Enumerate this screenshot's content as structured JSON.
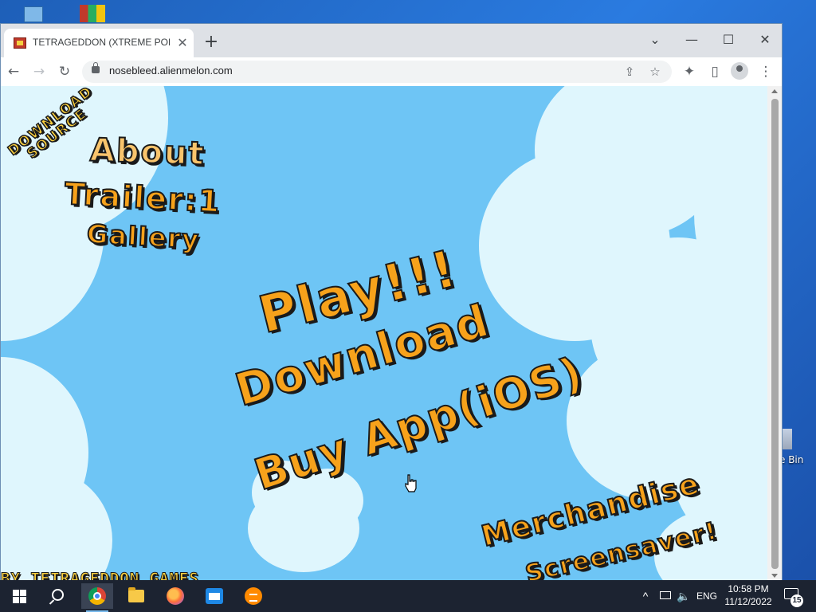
{
  "browser": {
    "tab_title": "TETRAGEDDON (XTREME POLYGON",
    "tab_close": "✕",
    "new_tab": "+",
    "url": "nosebleed.alienmelon.com",
    "window_controls": {
      "list": "⌄",
      "minimize": "—",
      "maximize": "☐",
      "close": "✕"
    },
    "nav": {
      "back": "←",
      "forward": "→",
      "reload": "↻",
      "share": "⇪",
      "bookmark": "☆",
      "extensions": "✦",
      "sidebar": "▯",
      "menu": "⋮"
    }
  },
  "page": {
    "download_label": "DOWNLOAD",
    "source_label": "SOURCE",
    "about_label": "About",
    "trailer_label": "Trailer:1",
    "gallery_label": "Gallery",
    "play_label": "Play!!!",
    "download_main_label": "Download",
    "buy_app_label": "Buy App(iOS)",
    "merchandise_label": "Merchandise",
    "screensaver_label": "Screensaver!",
    "footer_credit": "BY TETRAGEDDON GAMES"
  },
  "desktop": {
    "recycle_bin_label": "e Bin"
  },
  "taskbar": {
    "language": "ENG",
    "time": "10:58 PM",
    "date": "11/12/2022",
    "notifications_count": "15",
    "tray_chevron": "^"
  },
  "colors": {
    "sky": "#6ec5f5",
    "cloud": "#dff6fd",
    "title_orange": "#f7a21b",
    "title_yellow": "#ffd23e",
    "outline": "#1a1a1a"
  },
  "icons": [
    "desktop-computer-icon",
    "desktop-app-icon",
    "recycle-bin-icon",
    "tab-favicon",
    "lock-icon",
    "start-icon",
    "search-icon",
    "chrome-icon",
    "file-explorer-icon",
    "firefox-icon",
    "sandbox-icon",
    "sublime-icon",
    "network-icon",
    "volume-icon",
    "notification-icon",
    "hand-cursor-icon"
  ]
}
